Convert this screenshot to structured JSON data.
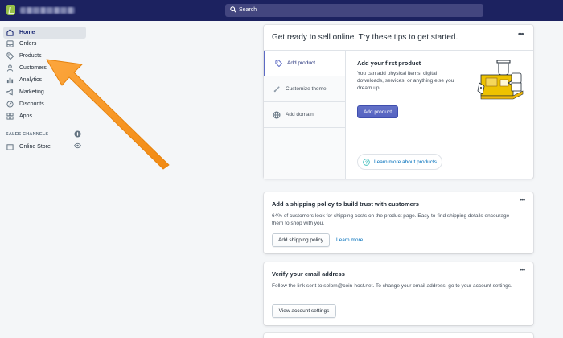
{
  "topbar": {
    "search_placeholder": "Search"
  },
  "sidebar": {
    "items": [
      {
        "label": "Home",
        "icon": "home-icon"
      },
      {
        "label": "Orders",
        "icon": "orders-icon"
      },
      {
        "label": "Products",
        "icon": "tag-icon"
      },
      {
        "label": "Customers",
        "icon": "person-icon"
      },
      {
        "label": "Analytics",
        "icon": "analytics-icon"
      },
      {
        "label": "Marketing",
        "icon": "megaphone-icon"
      },
      {
        "label": "Discounts",
        "icon": "discount-icon"
      },
      {
        "label": "Apps",
        "icon": "apps-icon"
      }
    ],
    "sales_channels_heading": "SALES CHANNELS",
    "online_store": "Online Store"
  },
  "tips_card": {
    "title": "Get ready to sell online. Try these tips to get started.",
    "tabs": [
      {
        "label": "Add product"
      },
      {
        "label": "Customize theme"
      },
      {
        "label": "Add domain"
      }
    ],
    "heading": "Add your first product",
    "description": "You can add physical items, digital downloads, services, or anything else you dream up.",
    "button": "Add product",
    "learn_more": "Learn more about products"
  },
  "shipping_card": {
    "title": "Add a shipping policy to build trust with customers",
    "description": "64% of customers look for shipping costs on the product page. Easy-to-find shipping details encourage them to shop with you.",
    "button": "Add shipping policy",
    "link": "Learn more"
  },
  "email_card": {
    "title": "Verify your email address",
    "description": "Follow the link sent to solom@coin-host.net. To change your email address, go to your account settings.",
    "button": "View account settings"
  },
  "colors": {
    "topbar": "#1c2260",
    "accent": "#5c6ac4",
    "arrow": "#f8931d",
    "link": "#006fbb"
  }
}
